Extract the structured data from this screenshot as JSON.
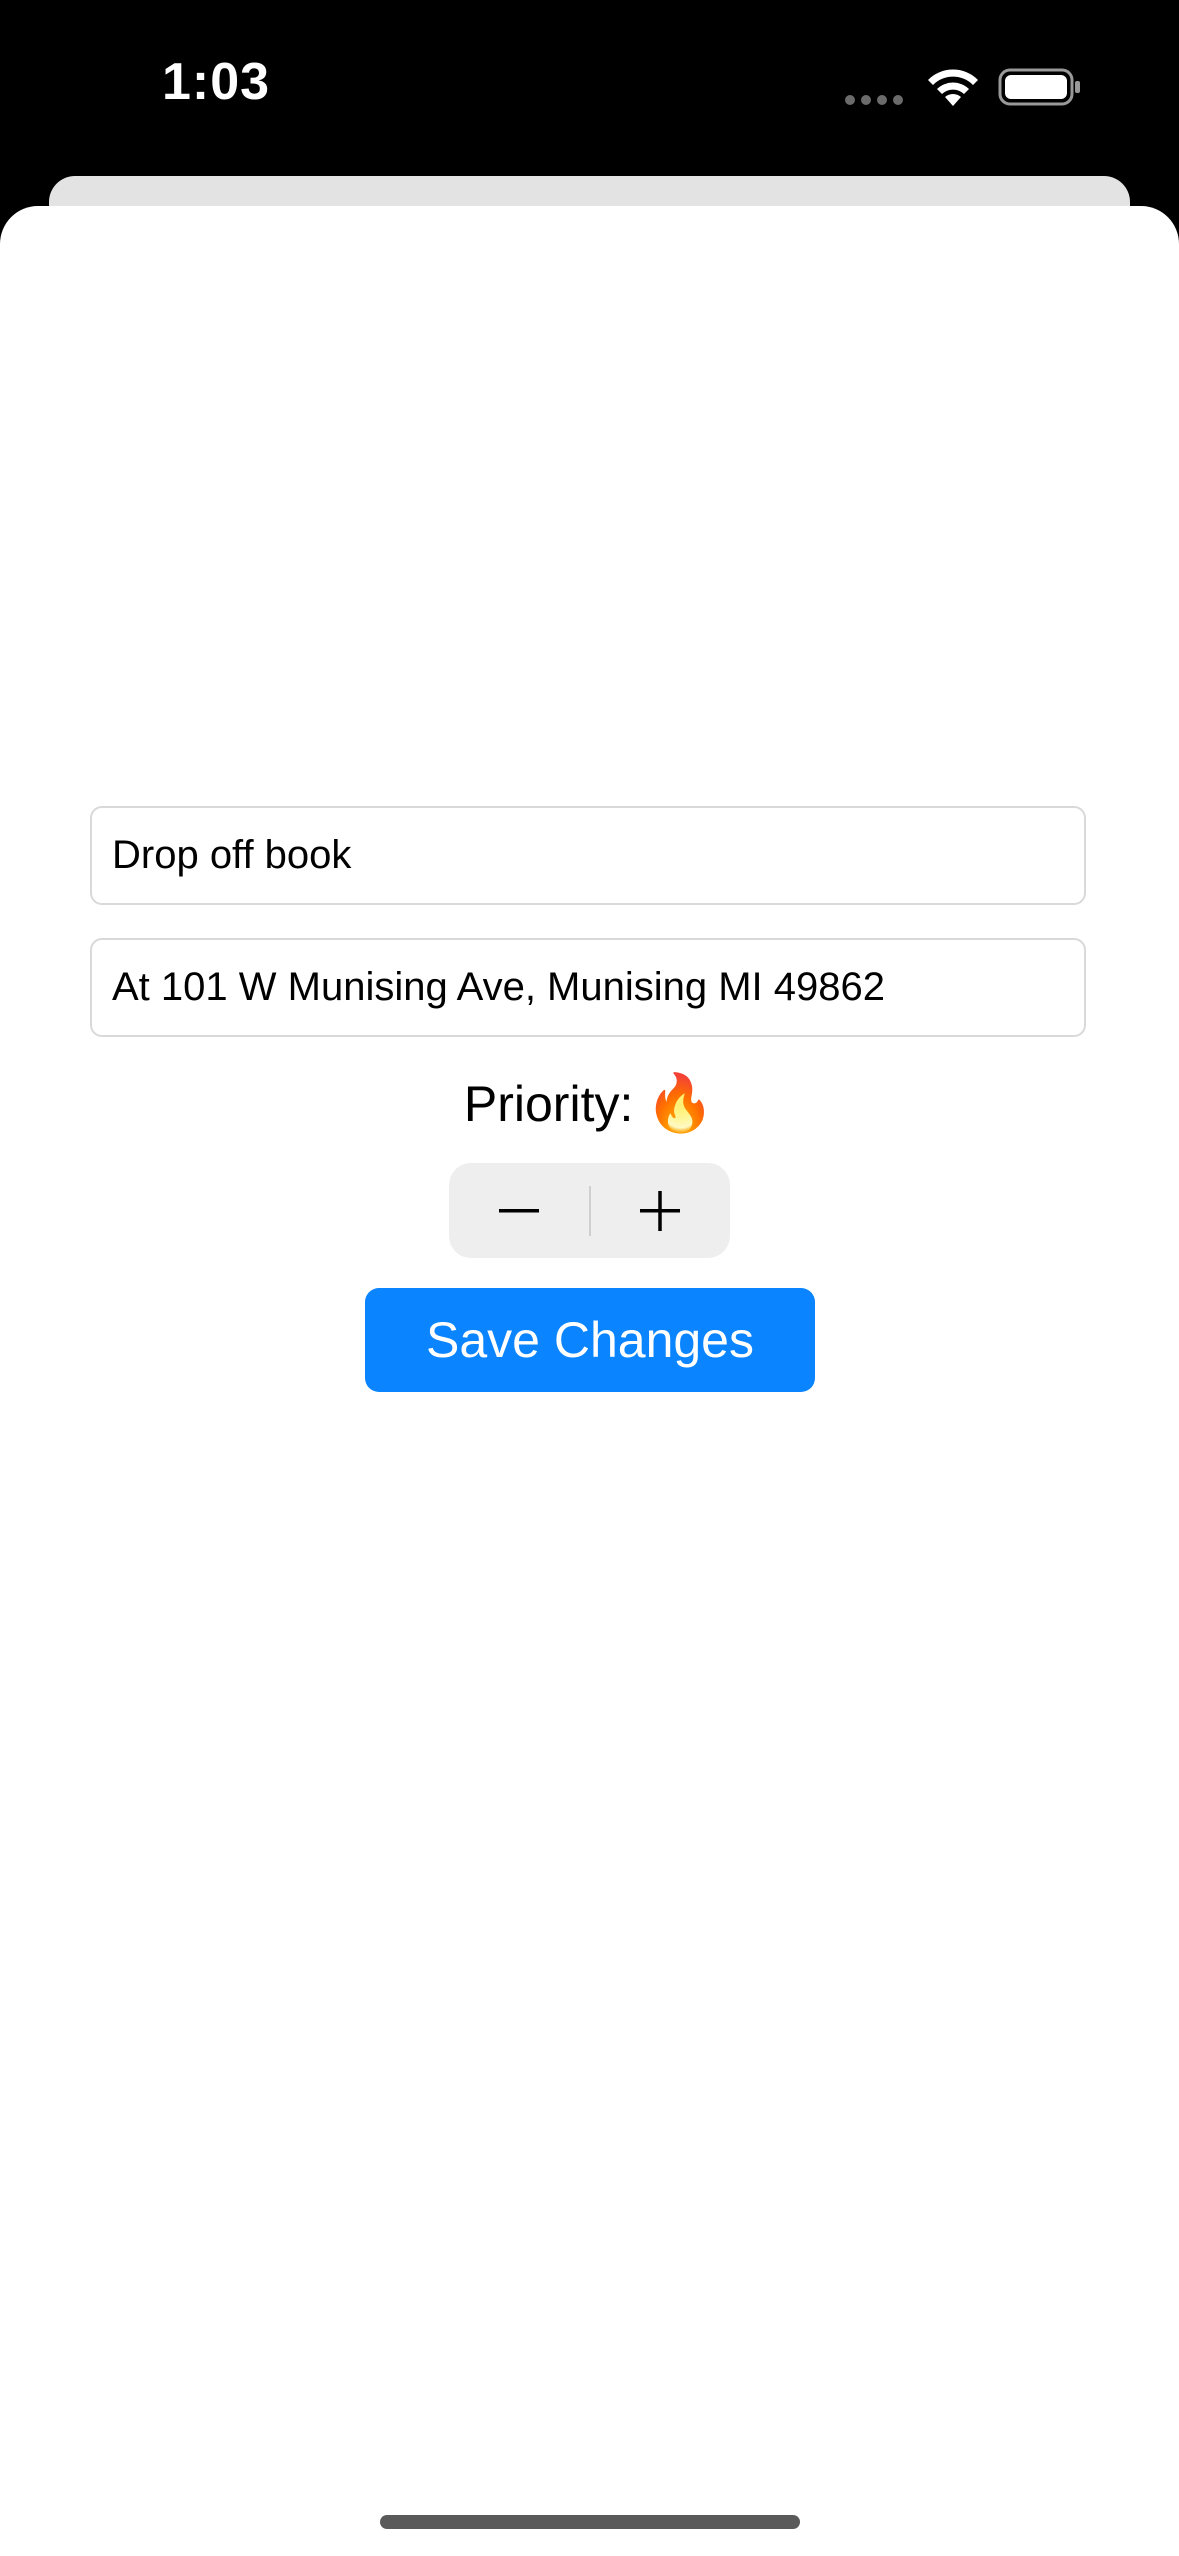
{
  "status_bar": {
    "time": "1:03",
    "icons": [
      "signal-dots-icon",
      "wifi-icon",
      "battery-icon"
    ]
  },
  "form": {
    "title_field": {
      "value": "Drop off book"
    },
    "location_field": {
      "value": "At 101 W Munising Ave, Munising MI 49862"
    },
    "priority": {
      "label": "Priority:",
      "emoji": "🔥",
      "icon": "fire-icon"
    },
    "stepper": {
      "decrement_icon": "minus-icon",
      "increment_icon": "plus-icon"
    },
    "save_label": "Save Changes"
  },
  "colors": {
    "accent": "#0a84ff",
    "stepper_bg": "#eeeeef",
    "field_border": "#d9d9d9"
  }
}
